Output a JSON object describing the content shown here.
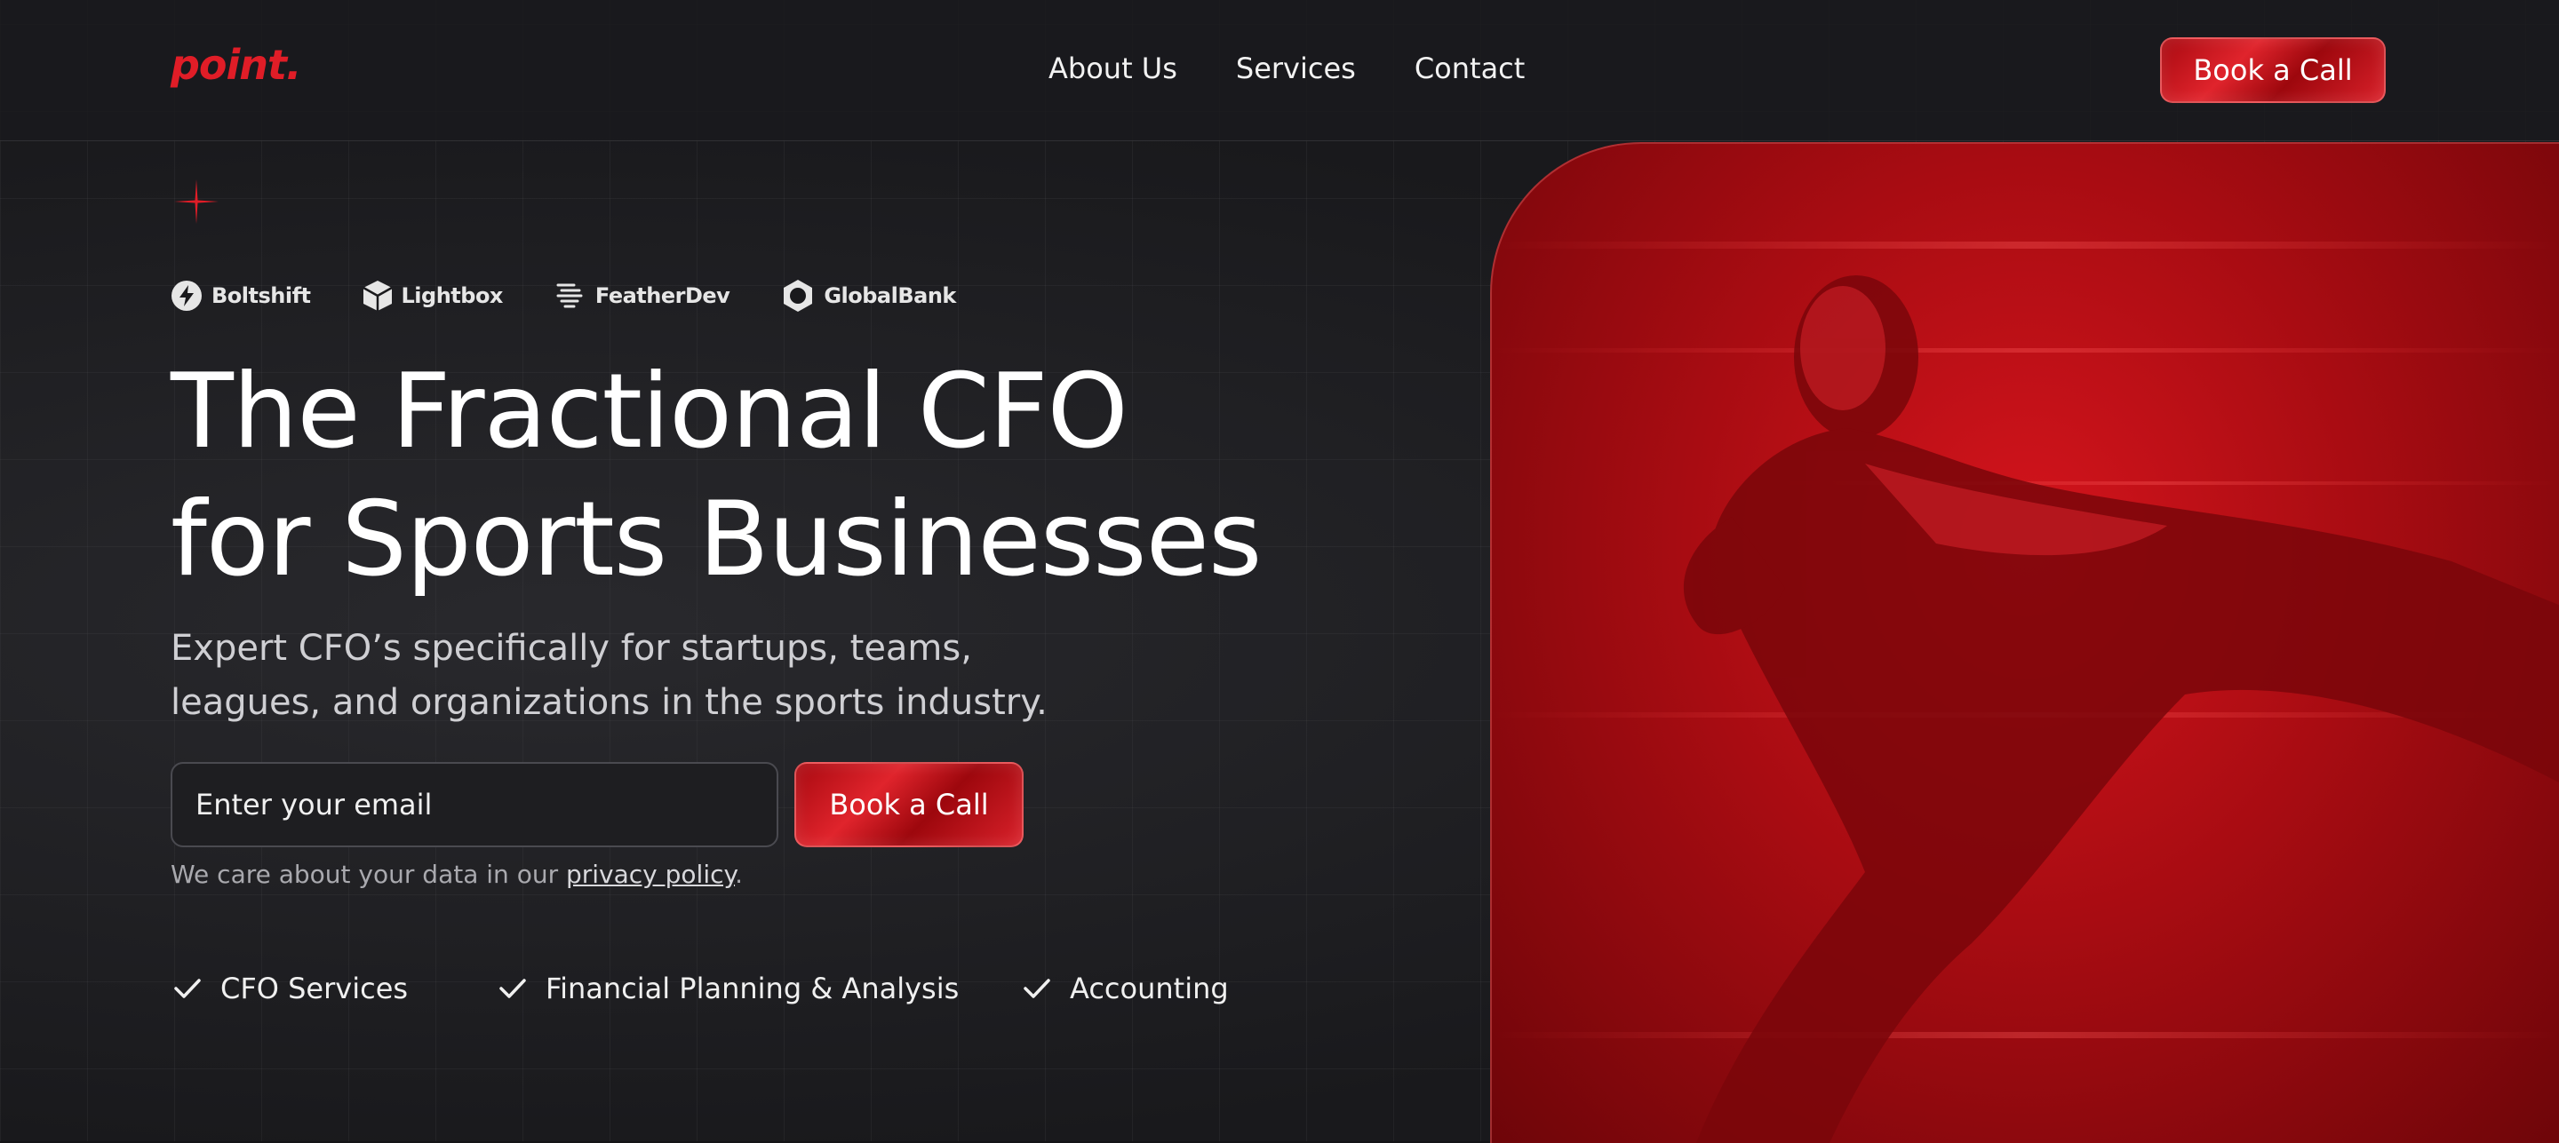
{
  "brand": {
    "logo_text": "point.",
    "accent_color": "#e01d27"
  },
  "nav": {
    "items": [
      {
        "label": "About Us"
      },
      {
        "label": "Services"
      },
      {
        "label": "Contact"
      }
    ],
    "cta_label": "Book a Call"
  },
  "partners": [
    {
      "name": "Boltshift",
      "icon": "bolt-icon"
    },
    {
      "name": "Lightbox",
      "icon": "cube-icon"
    },
    {
      "name": "FeatherDev",
      "icon": "feather-icon"
    },
    {
      "name": "GlobalBank",
      "icon": "hexagon-ring-icon"
    }
  ],
  "hero": {
    "headline_line1": "The Fractional CFO",
    "headline_line2": "for Sports Businesses",
    "subhead_line1": "Expert CFO’s specifically for startups, teams,",
    "subhead_line2": "leagues, and organizations in the sports industry.",
    "email_placeholder": "Enter your email",
    "cta_label": "Book a Call",
    "privacy_prefix": "We care about your data in our ",
    "privacy_link": "privacy policy",
    "privacy_suffix": "."
  },
  "features": [
    {
      "label": "CFO Services",
      "icon": "check-icon"
    },
    {
      "label": "Financial Planning & Analysis",
      "icon": "check-icon"
    },
    {
      "label": "Accounting",
      "icon": "check-icon"
    }
  ],
  "image": {
    "subject": "sprinting-athlete-red-photo"
  }
}
